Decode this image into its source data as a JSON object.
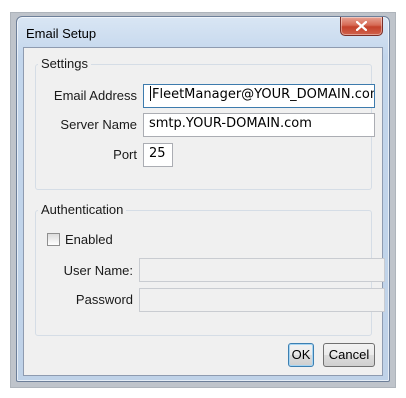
{
  "window": {
    "title": "Email Setup",
    "close_icon": "close-icon"
  },
  "settings": {
    "group_title": "Settings",
    "email_label": "Email Address",
    "email_value": "FleetManager@YOUR_DOMAIN.com",
    "server_label": "Server Name",
    "server_value": "smtp.YOUR-DOMAIN.com",
    "port_label": "Port",
    "port_value": "25"
  },
  "authentication": {
    "group_title": "Authentication",
    "enabled_label": "Enabled",
    "enabled_checked": false,
    "username_label": "User Name:",
    "username_value": "",
    "password_label": "Password",
    "password_value": ""
  },
  "buttons": {
    "ok_label": "OK",
    "cancel_label": "Cancel"
  }
}
